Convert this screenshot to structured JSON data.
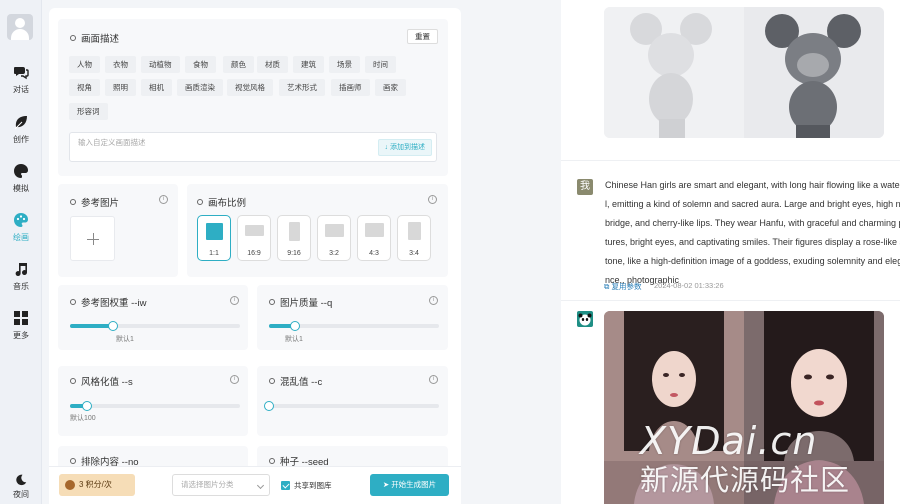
{
  "nav": {
    "items": [
      {
        "label": "对话",
        "icon": "chat-icon"
      },
      {
        "label": "创作",
        "icon": "leaf-icon"
      },
      {
        "label": "模拟",
        "icon": "simulate-icon"
      },
      {
        "label": "绘画",
        "icon": "palette-icon",
        "active": true
      },
      {
        "label": "音乐",
        "icon": "music-icon"
      },
      {
        "label": "更多",
        "icon": "grid-icon"
      },
      {
        "label": "夜间",
        "icon": "moon-icon"
      }
    ]
  },
  "description": {
    "title": "画面描述",
    "reset_label": "重置",
    "tags_row1": [
      "人物",
      "衣物",
      "动植物",
      "食物",
      "颜色",
      "材质",
      "建筑",
      "场景",
      "时间"
    ],
    "tags_row2": [
      "视角",
      "照明",
      "相机",
      "画质渲染",
      "视觉风格",
      "艺术形式",
      "插画师",
      "画家"
    ],
    "tags_row3": [
      "形容词"
    ],
    "input_placeholder": "输入自定义画面描述",
    "add_label": "添加到描述"
  },
  "reference": {
    "title": "参考图片"
  },
  "canvas": {
    "title": "画布比例",
    "ratios": [
      "1:1",
      "16:9",
      "9:16",
      "3:2",
      "4:3",
      "3:4"
    ],
    "selected": "1:1"
  },
  "sliders": {
    "iw": {
      "title": "参考图权重 --iw",
      "value": 0.25,
      "hint": "默认1"
    },
    "q": {
      "title": "图片质量 --q",
      "value": 0.15,
      "hint": "默认1"
    },
    "s": {
      "title": "风格化值 --s",
      "value": 0.1,
      "hint": "默认100"
    },
    "c": {
      "title": "混乱值 --c",
      "value": 0.0
    },
    "no": {
      "title": "排除内容 --no"
    },
    "seed": {
      "title": "种子 --seed"
    }
  },
  "bottom": {
    "credits": "3 积分/次",
    "category_placeholder": "请选择图片分类",
    "share_label": "共享到图库",
    "share_checked": true,
    "generate_label": "开始生成图片"
  },
  "chat": {
    "user_avatar": "我",
    "message_lines": [
      "Chinese Han girls are smart and elegant, with long hair flowing like a waterfal",
      "l, emitting a kind of solemn and sacred aura. Large and bright eyes, high nose",
      "bridge, and cherry-like lips. They wear Hanfu, with graceful and charming pos",
      "tures, bright eyes, and captivating smiles. Their figures display a rose-like skin",
      "tone, like a high-definition image of a goddess, exuding solemnity and elega",
      "nce., photographic"
    ],
    "copy_label": "复用参数",
    "timestamp": "2024-08-02 01:33:26"
  },
  "watermark": {
    "line1": "XYDai.cn",
    "line2": "新源代源码社区"
  },
  "colors": {
    "accent": "#2eaec4",
    "credits_bg": "#f6ddb7"
  }
}
